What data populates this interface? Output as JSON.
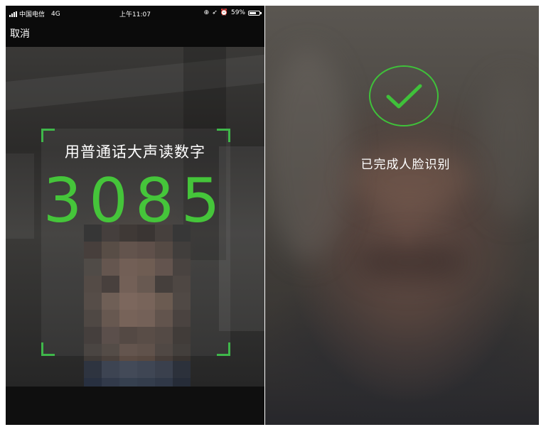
{
  "left_screen": {
    "status_bar": {
      "carrier": "中国电信",
      "network": "4G",
      "time": "上午11:07",
      "battery": "59%",
      "icons": [
        "signal-icon",
        "location-icon",
        "alarm-icon",
        "battery-icon"
      ]
    },
    "nav": {
      "cancel_label": "取消"
    },
    "instruction": "用普通话大声读数字",
    "code": "3085",
    "colors": {
      "accent_green": "#45c53a",
      "frame_green": "#3fb74a"
    }
  },
  "right_screen": {
    "success_icon": "check-circle-icon",
    "status_text": "已完成人脸识别"
  }
}
